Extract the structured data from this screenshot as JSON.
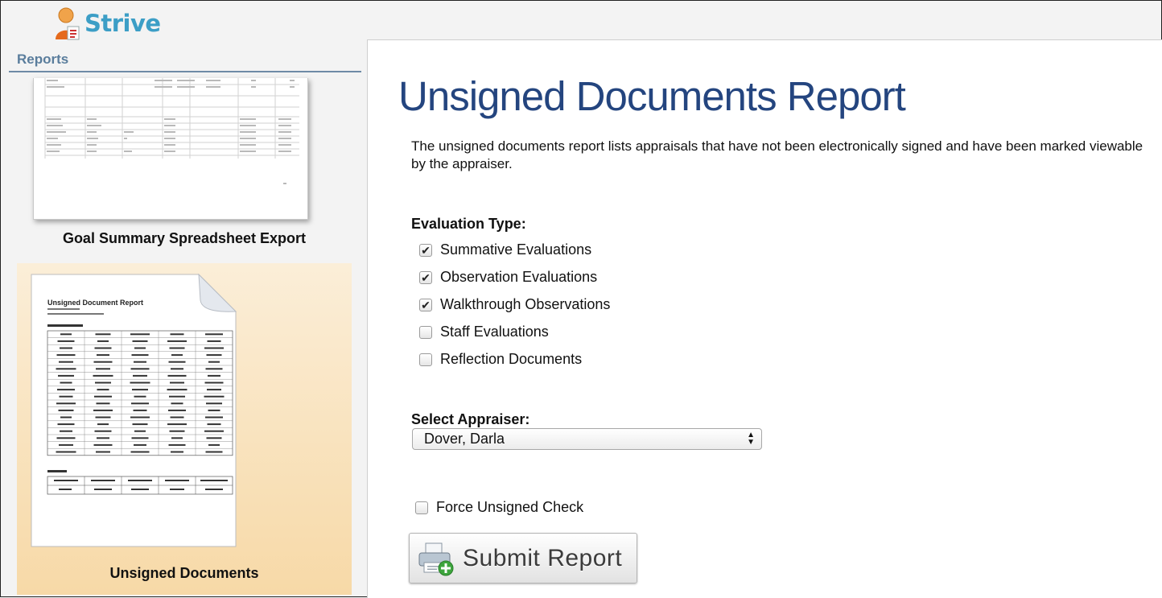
{
  "app": {
    "name": "Strive"
  },
  "sidebar": {
    "section_title": "Reports",
    "items": [
      {
        "label": "Goal Summary Spreadsheet Export"
      },
      {
        "label": "Unsigned Documents",
        "thumb_title": "Unsigned Document Report"
      }
    ]
  },
  "main": {
    "title": "Unsigned Documents Report",
    "description": "The unsigned documents report lists appraisals that have not been electronically signed and have been marked viewable by the appraiser.",
    "evaluation_type": {
      "label": "Evaluation Type:",
      "options": [
        {
          "label": "Summative Evaluations",
          "checked": true
        },
        {
          "label": "Observation Evaluations",
          "checked": true
        },
        {
          "label": "Walkthrough Observations",
          "checked": true
        },
        {
          "label": "Staff Evaluations",
          "checked": false
        },
        {
          "label": "Reflection Documents",
          "checked": false
        }
      ]
    },
    "appraiser": {
      "label": "Select Appraiser:",
      "selected": "Dover, Darla"
    },
    "force_unsigned": {
      "label": "Force Unsigned Check",
      "checked": false
    },
    "submit": {
      "label": "Submit Report",
      "icon": "printer-add-icon"
    }
  },
  "colors": {
    "title": "#24457f",
    "logo": "#3c9ec6",
    "selected_card": "#f7d9a7"
  }
}
